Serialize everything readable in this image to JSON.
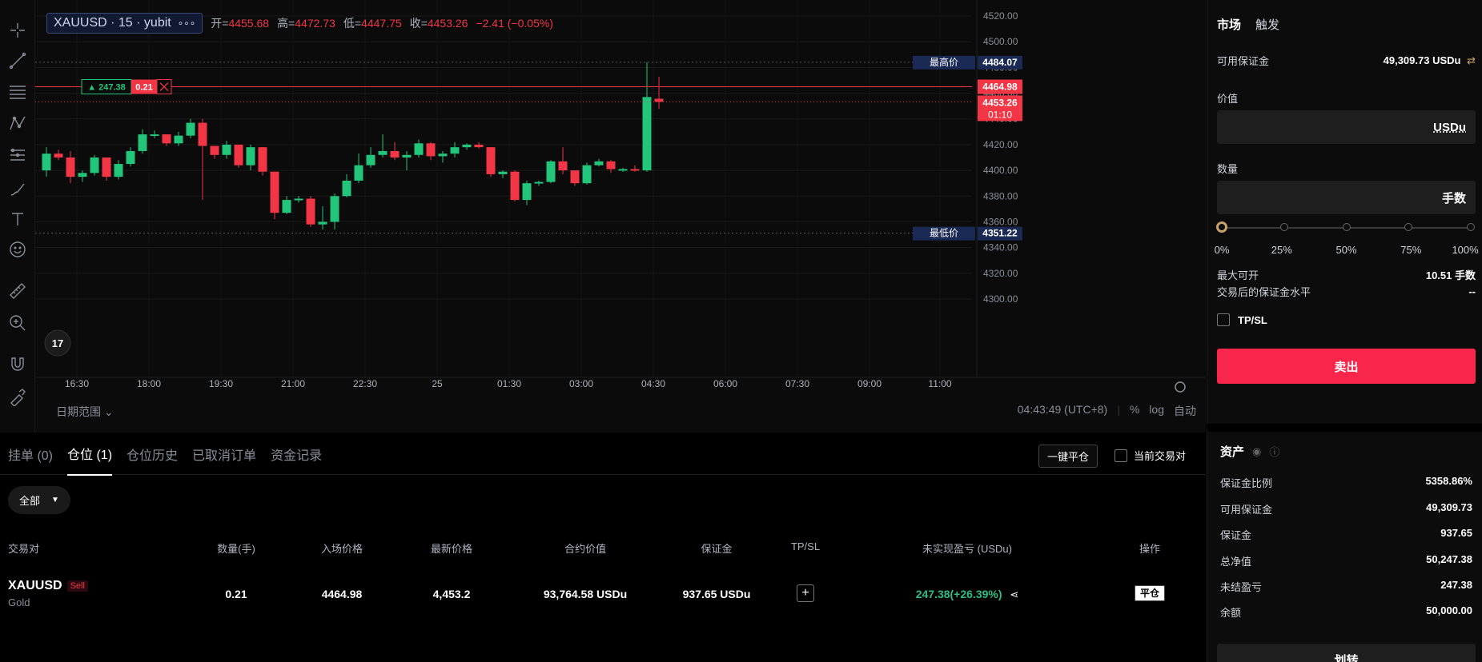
{
  "symbol": {
    "name": "XAUUSD · 15 · yubit",
    "more": "∘∘∘"
  },
  "ohlc": {
    "open_label": "开=",
    "open": "4455.68",
    "high_label": "高=",
    "high": "4472.73",
    "low_label": "低=",
    "low": "4447.75",
    "close_label": "收=",
    "close": "4453.26",
    "change": "−2.41 (−0.05%)"
  },
  "chart": {
    "price_ticks": [
      "4520.00",
      "4500.00",
      "4480.00",
      "4460.00",
      "4440.00",
      "4420.00",
      "4400.00",
      "4380.00",
      "4360.00",
      "4340.00",
      "4320.00",
      "4300.00"
    ],
    "time_ticks": [
      "16:30",
      "18:00",
      "19:30",
      "21:00",
      "22:30",
      "25",
      "01:30",
      "03:00",
      "04:30",
      "06:00",
      "07:30",
      "09:00",
      "11:00"
    ],
    "high_label": "最高价",
    "high_value": "4484.07",
    "low_label": "最低价",
    "low_value": "4351.22",
    "entry_price": "4464.98",
    "current_price": "4453.26",
    "countdown": "01:10",
    "position_pnl": "▲ 247.38",
    "position_qty": "0.21",
    "up_color": "#22c57a",
    "down_color": "#f23645",
    "date_range": "日期范围",
    "clock": "04:43:49 (UTC+8)",
    "pct": "%",
    "log": "log",
    "auto": "自动"
  },
  "tabs": [
    {
      "label": "挂单 (0)"
    },
    {
      "label": "仓位 (1)"
    },
    {
      "label": "仓位历史"
    },
    {
      "label": "已取消订单"
    },
    {
      "label": "资金记录"
    }
  ],
  "actions": {
    "close_all": "一键平仓",
    "current_pair": "当前交易对",
    "filter": "全部"
  },
  "table": {
    "headers": [
      "交易对",
      "数量(手)",
      "入场价格",
      "最新价格",
      "合约价值",
      "保证金",
      "TP/SL",
      "未实现盈亏 (USDu)",
      "操作"
    ],
    "row": {
      "symbol": "XAUUSD",
      "side": "Sell",
      "sub": "Gold",
      "qty": "0.21",
      "entry": "4464.98",
      "last": "4,453.2",
      "value": "93,764.58 USDu",
      "margin": "937.65 USDu",
      "tpsl": "+",
      "pnl": "247.38(+26.39%)",
      "action": "平仓"
    }
  },
  "order": {
    "tab_market": "市场",
    "tab_trigger": "触发",
    "avail_label": "可用保证金",
    "avail_value": "49,309.73 USDu",
    "value_label": "价值",
    "value_unit": "USDu",
    "qty_label": "数量",
    "qty_unit": "手数",
    "slider_pct": 0,
    "pcts": [
      "0%",
      "25%",
      "50%",
      "75%",
      "100%"
    ],
    "max_label": "最大可开",
    "max_value": "10.51 手数",
    "after_label": "交易后的保证金水平",
    "after_value": "--",
    "tpsl": "TP/SL",
    "sell": "卖出"
  },
  "assets": {
    "title": "资产",
    "rows": [
      {
        "label": "保证金比例",
        "value": "5358.86%"
      },
      {
        "label": "可用保证金",
        "value": "49,309.73"
      },
      {
        "label": "保证金",
        "value": "937.65"
      },
      {
        "label": "总净值",
        "value": "50,247.38"
      },
      {
        "label": "未结盈亏",
        "value": "247.38"
      },
      {
        "label": "余额",
        "value": "50,000.00"
      }
    ],
    "transfer": "划转"
  },
  "chart_data": {
    "type": "candlestick",
    "ylim": [
      4290,
      4525
    ],
    "candles": [
      {
        "o": 4400,
        "h": 4418,
        "l": 4395,
        "c": 4413
      },
      {
        "o": 4413,
        "h": 4416,
        "l": 4408,
        "c": 4410
      },
      {
        "o": 4410,
        "h": 4415,
        "l": 4390,
        "c": 4395
      },
      {
        "o": 4395,
        "h": 4400,
        "l": 4391,
        "c": 4398
      },
      {
        "o": 4398,
        "h": 4412,
        "l": 4396,
        "c": 4410
      },
      {
        "o": 4410,
        "h": 4410,
        "l": 4392,
        "c": 4395
      },
      {
        "o": 4395,
        "h": 4408,
        "l": 4393,
        "c": 4405
      },
      {
        "o": 4405,
        "h": 4418,
        "l": 4403,
        "c": 4415
      },
      {
        "o": 4415,
        "h": 4432,
        "l": 4413,
        "c": 4428
      },
      {
        "o": 4428,
        "h": 4431,
        "l": 4425,
        "c": 4428
      },
      {
        "o": 4428,
        "h": 4428,
        "l": 4419,
        "c": 4421
      },
      {
        "o": 4421,
        "h": 4430,
        "l": 4419,
        "c": 4427
      },
      {
        "o": 4427,
        "h": 4440,
        "l": 4425,
        "c": 4437
      },
      {
        "o": 4437,
        "h": 4440,
        "l": 4377,
        "c": 4419
      },
      {
        "o": 4419,
        "h": 4419,
        "l": 4409,
        "c": 4412
      },
      {
        "o": 4412,
        "h": 4423,
        "l": 4409,
        "c": 4420
      },
      {
        "o": 4420,
        "h": 4420,
        "l": 4402,
        "c": 4404
      },
      {
        "o": 4404,
        "h": 4420,
        "l": 4400,
        "c": 4418
      },
      {
        "o": 4418,
        "h": 4418,
        "l": 4396,
        "c": 4399
      },
      {
        "o": 4399,
        "h": 4399,
        "l": 4362,
        "c": 4367
      },
      {
        "o": 4367,
        "h": 4380,
        "l": 4366,
        "c": 4377
      },
      {
        "o": 4377,
        "h": 4380,
        "l": 4375,
        "c": 4378
      },
      {
        "o": 4378,
        "h": 4380,
        "l": 4356,
        "c": 4358
      },
      {
        "o": 4358,
        "h": 4372,
        "l": 4354,
        "c": 4360
      },
      {
        "o": 4360,
        "h": 4382,
        "l": 4354,
        "c": 4380
      },
      {
        "o": 4380,
        "h": 4397,
        "l": 4379,
        "c": 4392
      },
      {
        "o": 4392,
        "h": 4413,
        "l": 4390,
        "c": 4404
      },
      {
        "o": 4404,
        "h": 4418,
        "l": 4402,
        "c": 4412
      },
      {
        "o": 4412,
        "h": 4428,
        "l": 4410,
        "c": 4415
      },
      {
        "o": 4415,
        "h": 4422,
        "l": 4408,
        "c": 4410
      },
      {
        "o": 4410,
        "h": 4415,
        "l": 4400,
        "c": 4412
      },
      {
        "o": 4412,
        "h": 4424,
        "l": 4410,
        "c": 4421
      },
      {
        "o": 4421,
        "h": 4422,
        "l": 4408,
        "c": 4411
      },
      {
        "o": 4411,
        "h": 4415,
        "l": 4406,
        "c": 4413
      },
      {
        "o": 4413,
        "h": 4422,
        "l": 4410,
        "c": 4418
      },
      {
        "o": 4418,
        "h": 4421,
        "l": 4416,
        "c": 4420
      },
      {
        "o": 4420,
        "h": 4422,
        "l": 4417,
        "c": 4418
      },
      {
        "o": 4418,
        "h": 4418,
        "l": 4395,
        "c": 4397
      },
      {
        "o": 4397,
        "h": 4400,
        "l": 4394,
        "c": 4399
      },
      {
        "o": 4399,
        "h": 4400,
        "l": 4376,
        "c": 4377
      },
      {
        "o": 4377,
        "h": 4392,
        "l": 4373,
        "c": 4390
      },
      {
        "o": 4390,
        "h": 4392,
        "l": 4388,
        "c": 4391
      },
      {
        "o": 4391,
        "h": 4408,
        "l": 4390,
        "c": 4407
      },
      {
        "o": 4407,
        "h": 4418,
        "l": 4397,
        "c": 4400
      },
      {
        "o": 4400,
        "h": 4400,
        "l": 4388,
        "c": 4390
      },
      {
        "o": 4390,
        "h": 4406,
        "l": 4389,
        "c": 4404
      },
      {
        "o": 4404,
        "h": 4409,
        "l": 4403,
        "c": 4407
      },
      {
        "o": 4407,
        "h": 4408,
        "l": 4398,
        "c": 4401
      },
      {
        "o": 4401,
        "h": 4402,
        "l": 4399,
        "c": 4401
      },
      {
        "o": 4401,
        "h": 4404,
        "l": 4399,
        "c": 4400
      },
      {
        "o": 4400,
        "h": 4484,
        "l": 4399,
        "c": 4457
      },
      {
        "o": 4455.68,
        "h": 4472.73,
        "l": 4447.75,
        "c": 4453.26
      }
    ]
  }
}
